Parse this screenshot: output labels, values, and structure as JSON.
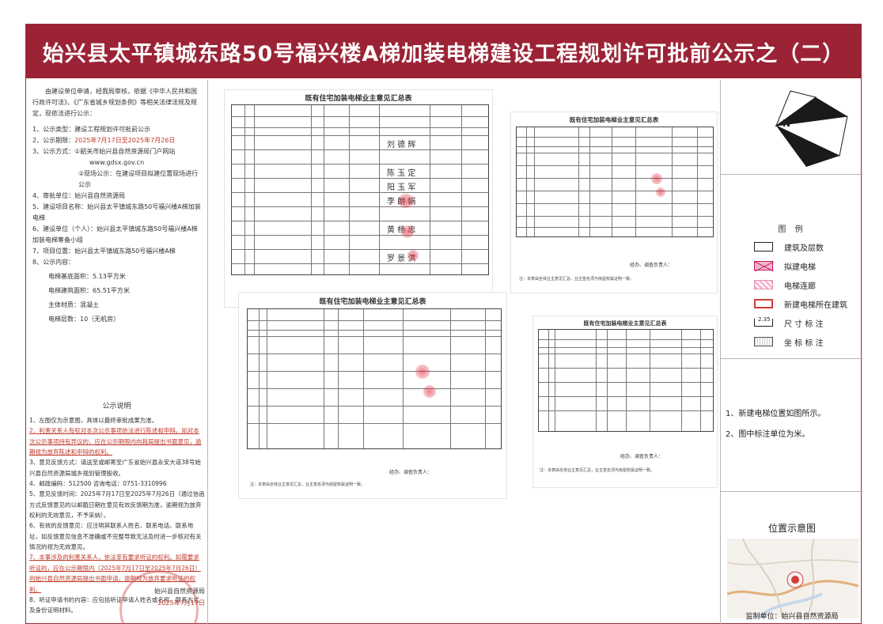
{
  "title": "始兴县太平镇城东路50号福兴楼A梯加装电梯建设工程规划许可批前公示之（二）",
  "left": {
    "intro": "由建设单位申请，经我局审核，依据《中华人民共和国行政许可法》、《广东省城乡规划条例》等相关法律法规及规定，现依法进行公示：",
    "items": [
      {
        "label": "1、公示类型：",
        "value": "建设工程规划许可批前公示"
      },
      {
        "label": "2、公示期限：",
        "value": "2025年7月17日至2025年7月26日"
      },
      {
        "label": "3、公示方式：",
        "value": "①韶关市始兴县自然资源局门户网站"
      },
      {
        "label": "",
        "value": "www.gdsx.gov.cn"
      },
      {
        "label": "",
        "value": "②现场公示：在建设项目拟建位置现场进行公示"
      },
      {
        "label": "4、审批单位：",
        "value": "始兴县自然资源局"
      },
      {
        "label": "5、建设项目名称：",
        "value": "始兴县太平镇城东路50号福兴楼A梯加装电梯"
      },
      {
        "label": "6、建设单位（个人）：",
        "value": "始兴县太平镇城东路50号福兴楼A梯加装电梯筹备小组"
      },
      {
        "label": "7、项目位置：",
        "value": "始兴县太平镇城东路50号福兴楼A梯"
      },
      {
        "label": "8、公示内容：",
        "value": ""
      }
    ],
    "content": [
      {
        "label": "电梯基底面积：",
        "value": "5.13平方米"
      },
      {
        "label": "电梯建筑面积：",
        "value": "65.51平方米"
      },
      {
        "label": "主体材质：",
        "value": "混凝土"
      },
      {
        "label": "电梯层数：",
        "value": "10（无机房）"
      }
    ],
    "notice_title": "公示说明",
    "notice": [
      "1、左图仅为示意图，具体以最终审批成果为准。",
      "2、利害关系人有权对本次公示事项依法进行陈述和申辩。如对本次公示事项持有异议的，应在公示期限内向我局提出书面意见，逾期视为放弃陈述和申辩的权利。",
      "3、意见反馈方式：请送至或邮寄至广东省始兴县永安大道38号始兴县自然资源局城乡规划管理股收。",
      "4、邮政编码：512500  咨询电话：0751-3310996",
      "5、意见反馈时间：2025年7月17日至2025年7月26日（通过信函方式反馈意见的以邮戳日期在意见有效反馈期为准，逾期视为放弃权利的无效意见，不予采纳）。",
      "6、有效的反馈意见：应注明其联系人姓名、联系电话、联系地址，如反馈意见信息不准确或不完整导致无法及时进一步核对有关情况的视为无效意见。",
      "7、本事涉及的利害关系人，依法享有要求听证的权利。如需要求听证的，应在公示期限内（2025年7月17日至2025年7月26日）向始兴县自然资源局提出书面申请，逾期视为放弃要求听证的权利。",
      "8、听证申请书的内容：应包括听证申请人姓名或名称、联系方式及身份证明材料。"
    ],
    "sign_org": "始兴县自然资源局",
    "sign_date": "2025年7月17日"
  },
  "docs": {
    "doc_title": "既有住宅加装电梯业主意见汇总表",
    "doc_note": "注：本表由全体业主意见汇总，业主签名须与房屋权属证明一致。",
    "sign_line": "经办、调查负责人："
  },
  "right": {
    "north_label": "N",
    "legend_title": "图 例",
    "legend": [
      {
        "label": "建筑及层数",
        "kind": "rect"
      },
      {
        "label": "拟建电梯",
        "kind": "elevator"
      },
      {
        "label": "电梯连廊",
        "kind": "hatch"
      },
      {
        "label": "新建电梯所在建筑",
        "kind": "red-rect"
      },
      {
        "label": "尺 寸 标 注",
        "kind": "dim",
        "sample": "2.35"
      },
      {
        "label": "坐 标 标 注",
        "kind": "coord"
      }
    ],
    "notes": [
      "1、新建电梯位置如图所示。",
      "2、图中标注单位为米。"
    ],
    "location_title": "位置示意图",
    "footer": "监制单位：始兴县自然资源局"
  }
}
